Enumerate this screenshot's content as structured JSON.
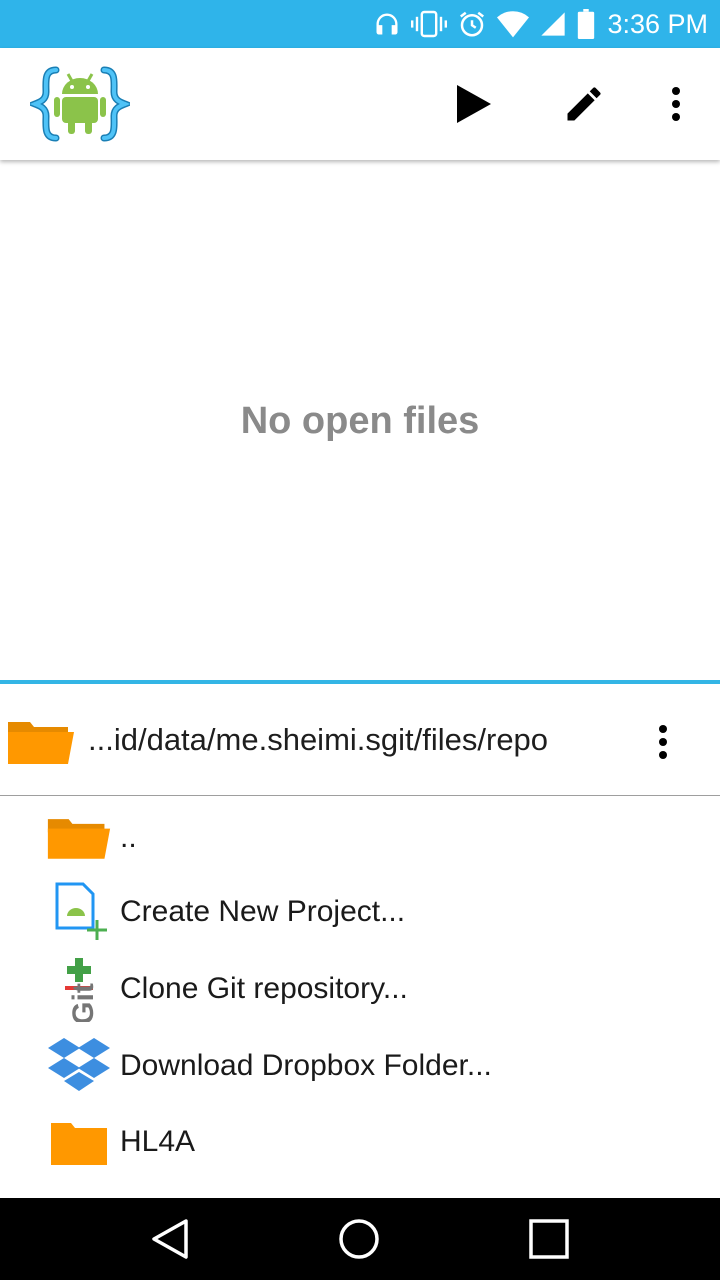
{
  "status_bar": {
    "time": "3:36 PM",
    "bg_color": "#2fb4ea"
  },
  "app_bar": {
    "logo_icon": "android-braces-logo-icon",
    "actions": [
      {
        "icon": "play-icon"
      },
      {
        "icon": "pencil-icon"
      },
      {
        "icon": "overflow-menu-icon"
      }
    ]
  },
  "editor": {
    "empty_message": "No open files"
  },
  "file_browser": {
    "path": "...id/data/me.sheimi.sgit/files/repo",
    "folder_color": "#ff9800",
    "items": [
      {
        "label": "..",
        "icon": "folder-open-icon"
      },
      {
        "label": "Create New Project...",
        "icon": "new-project-icon"
      },
      {
        "label": "Clone Git repository...",
        "icon": "git-clone-icon"
      },
      {
        "label": "Download Dropbox Folder...",
        "icon": "dropbox-icon"
      },
      {
        "label": "HL4A",
        "icon": "folder-icon"
      }
    ]
  },
  "nav_bar": {
    "buttons": [
      "back-icon",
      "home-icon",
      "recents-icon"
    ]
  }
}
